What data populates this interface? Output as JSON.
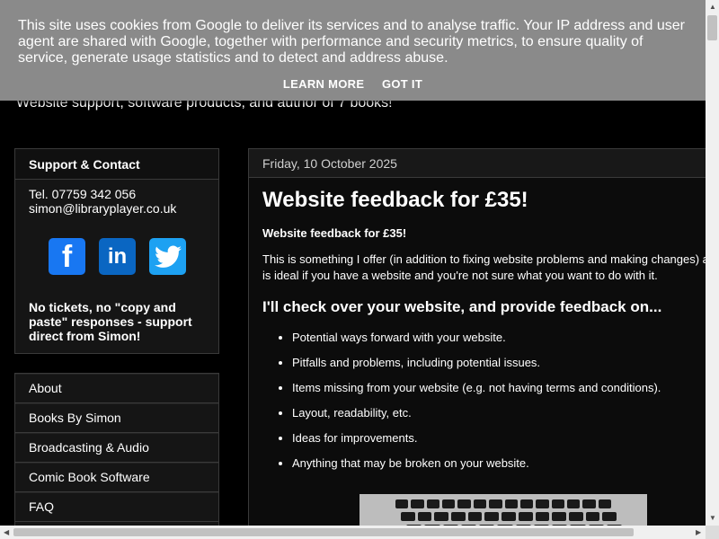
{
  "header": {
    "tagline": "Website support, software products, and author of 7 books!"
  },
  "cookie_banner": {
    "text": "This site uses cookies from Google to deliver its services and to analyse traffic. Your IP address and user agent are shared with Google, together with performance and security metrics, to ensure quality of service, generate usage statistics and to detect and address abuse.",
    "learn_more": "LEARN MORE",
    "got_it": "GOT IT"
  },
  "support": {
    "title": "Support & Contact",
    "phone": "Tel. 07759 342 056",
    "email": "simon@libraryplayer.co.uk",
    "social": [
      "facebook-icon",
      "linkedin-icon",
      "twitter-icon"
    ],
    "note": "No tickets, no \"copy and paste\" responses - support direct from Simon!"
  },
  "menu": {
    "items": [
      "About",
      "Books By Simon",
      "Broadcasting & Audio",
      "Comic Book Software",
      "FAQ"
    ]
  },
  "post": {
    "date": "Friday, 10 October 2025",
    "title": "Website feedback for £35!",
    "subtitle": "Website feedback for £35!",
    "paragraph": "This is something I offer (in addition to fixing website problems and making changes) and is ideal if you have a website and you're not sure what you want to do with it.",
    "heading": "I'll check over your website, and provide feedback on...",
    "list": [
      "Potential ways forward with your website.",
      "Pitfalls and problems, including potential issues.",
      "Items missing from your website (e.g. not having terms and conditions).",
      "Layout, readability, etc.",
      "Ideas for improvements.",
      "Anything that may be broken on your website."
    ]
  },
  "colors": {
    "cookie_bg": "#8a8a8a",
    "facebook": "#1877f2",
    "linkedin": "#0a66c2",
    "twitter": "#1da1f2"
  }
}
